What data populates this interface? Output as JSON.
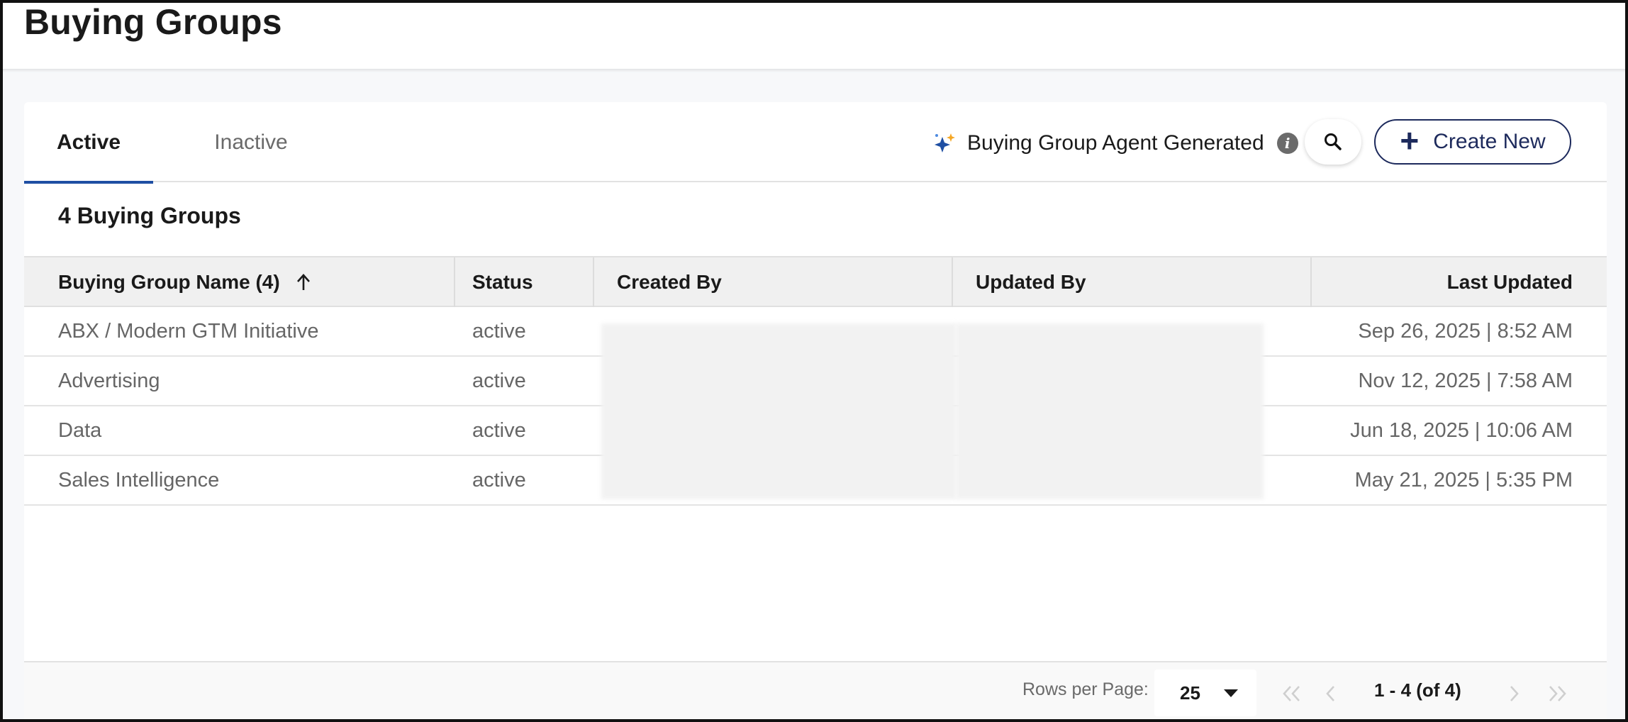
{
  "page": {
    "title": "Buying Groups"
  },
  "tabs": [
    {
      "label": "Active",
      "active": true
    },
    {
      "label": "Inactive",
      "active": false
    }
  ],
  "toolbar": {
    "agent_label": "Buying Group Agent Generated",
    "agent_icon": "sparkle-icon",
    "info_icon": "info-icon",
    "search_icon": "search-icon",
    "create_label": "Create New",
    "create_icon": "plus-icon"
  },
  "summary": {
    "count_label": "4 Buying Groups"
  },
  "table": {
    "columns": {
      "name": "Buying Group Name (4)",
      "status": "Status",
      "created_by": "Created By",
      "updated_by": "Updated By",
      "last_updated": "Last Updated"
    },
    "sort_icon": "arrow-up-icon",
    "rows": [
      {
        "name": "ABX / Modern GTM Initiative",
        "status": "active",
        "created_by": "",
        "updated_by": "",
        "last_updated": "Sep 26, 2025 | 8:52 AM"
      },
      {
        "name": "Advertising",
        "status": "active",
        "created_by": "",
        "updated_by": "",
        "last_updated": "Nov 12, 2025 | 7:58 AM"
      },
      {
        "name": "Data",
        "status": "active",
        "created_by": "",
        "updated_by": "",
        "last_updated": "Jun 18, 2025 | 10:06 AM"
      },
      {
        "name": "Sales Intelligence",
        "status": "active",
        "created_by": "",
        "updated_by": "",
        "last_updated": "May 21, 2025 | 5:35 PM"
      }
    ]
  },
  "pagination": {
    "rows_per_page_label": "Rows per Page:",
    "rows_per_page_value": "25",
    "range_label": "1 - 4 (of 4)"
  },
  "colors": {
    "accent": "#1f4fa3",
    "create_button": "#1d2a5c",
    "sparkle_primary": "#1f4fa3",
    "sparkle_secondary": "#f5a623"
  }
}
